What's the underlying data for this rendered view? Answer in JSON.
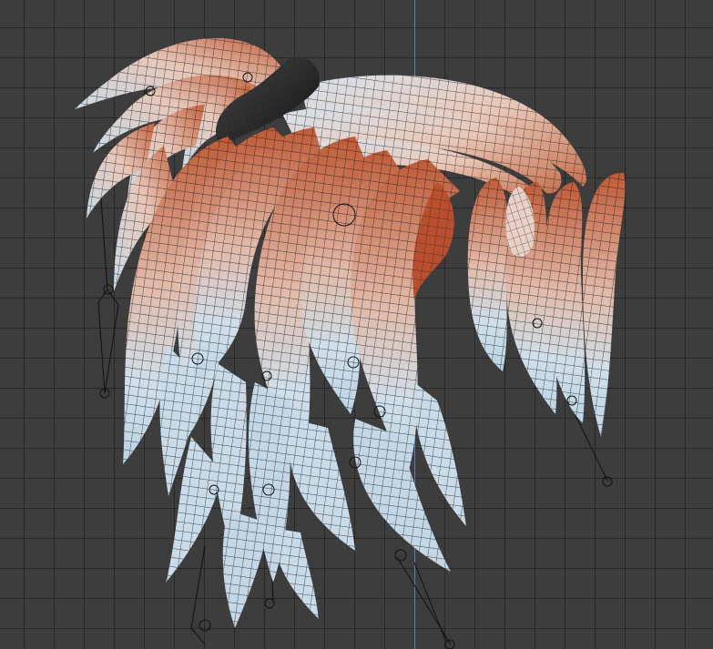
{
  "viewport": {
    "name": "3d-viewport",
    "background": "#3d3d3d",
    "grid_color": "#2f2f2f",
    "axis_color": "#5b7fb5",
    "mesh_root_color": "#c4623e",
    "mesh_tip_color": "#c9dbe8",
    "wire_color": "#1b1b1b",
    "band_color": "#2b2b2b",
    "bone_color": "#111111"
  }
}
